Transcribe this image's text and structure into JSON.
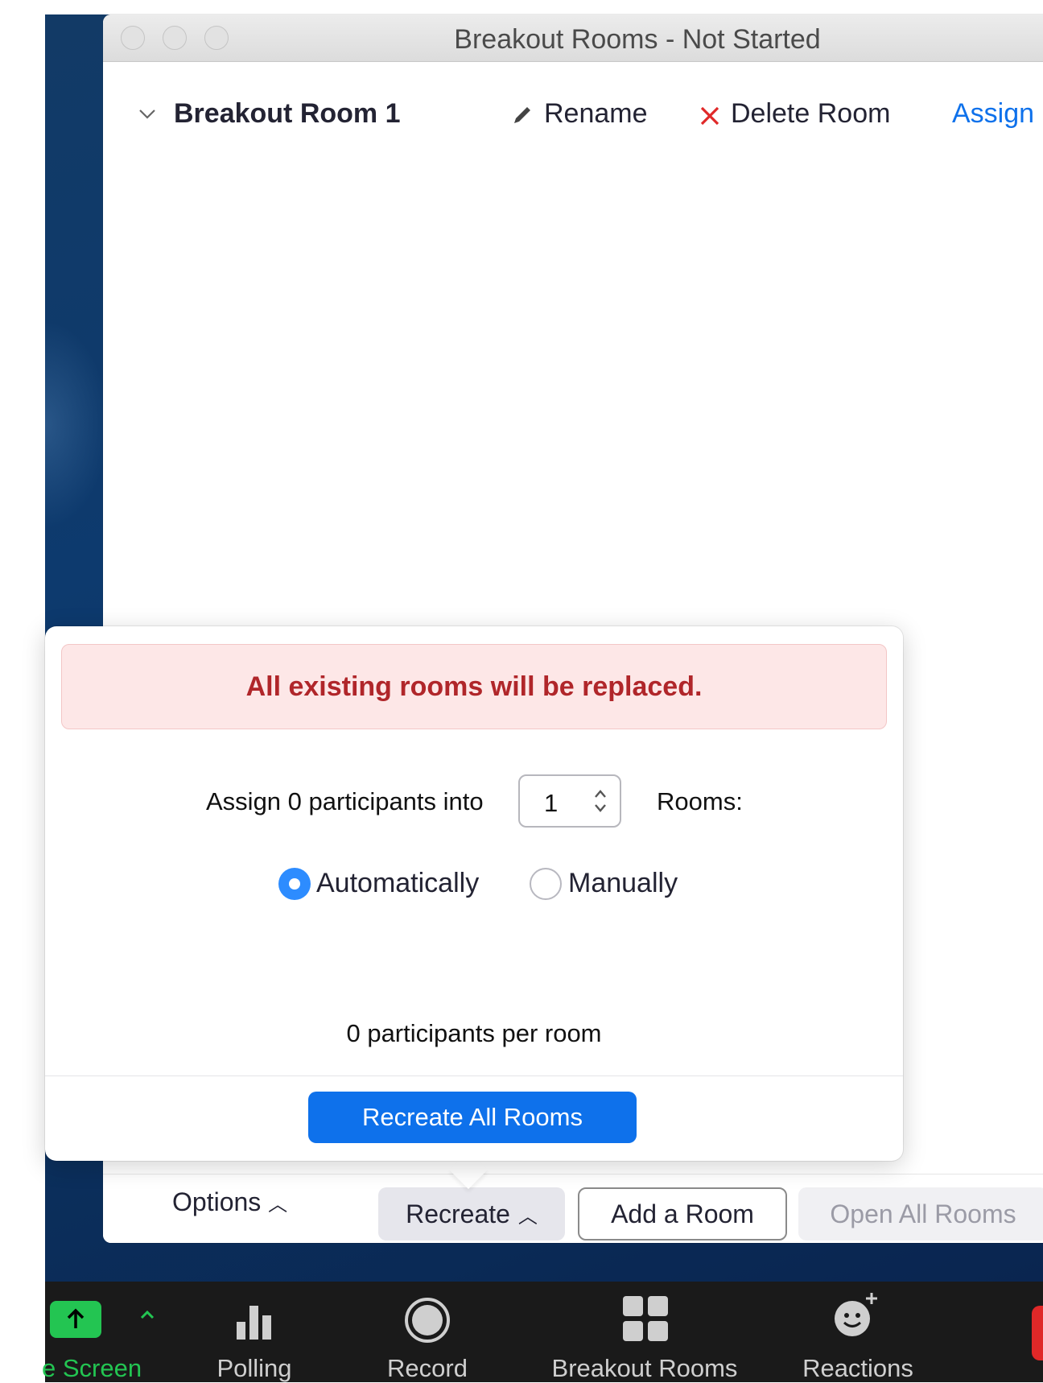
{
  "window": {
    "title": "Breakout Rooms - Not Started"
  },
  "room": {
    "name": "Breakout Room 1",
    "rename_label": "Rename",
    "delete_label": "Delete Room",
    "assign_label": "Assign"
  },
  "popup": {
    "warning": "All existing rooms will be replaced.",
    "assign_prefix": "Assign 0 participants into",
    "room_count": "1",
    "rooms_suffix": "Rooms:",
    "option_auto": "Automatically",
    "option_manual": "Manually",
    "selected_option": "Automatically",
    "per_room": "0 participants per room",
    "primary_button": "Recreate All Rooms"
  },
  "bottom_bar": {
    "options_label": "Options",
    "recreate_label": "Recreate",
    "add_room_label": "Add a Room",
    "open_all_label": "Open All Rooms"
  },
  "toolbar": {
    "share_screen_label": "e Screen",
    "polling_label": "Polling",
    "record_label": "Record",
    "breakout_label": "Breakout Rooms",
    "reactions_label": "Reactions"
  },
  "colors": {
    "accent_blue": "#0e71eb",
    "warning_text": "#b0262a",
    "warning_bg": "#fde7e7",
    "share_green": "#23c552",
    "delete_red": "#e02828"
  }
}
